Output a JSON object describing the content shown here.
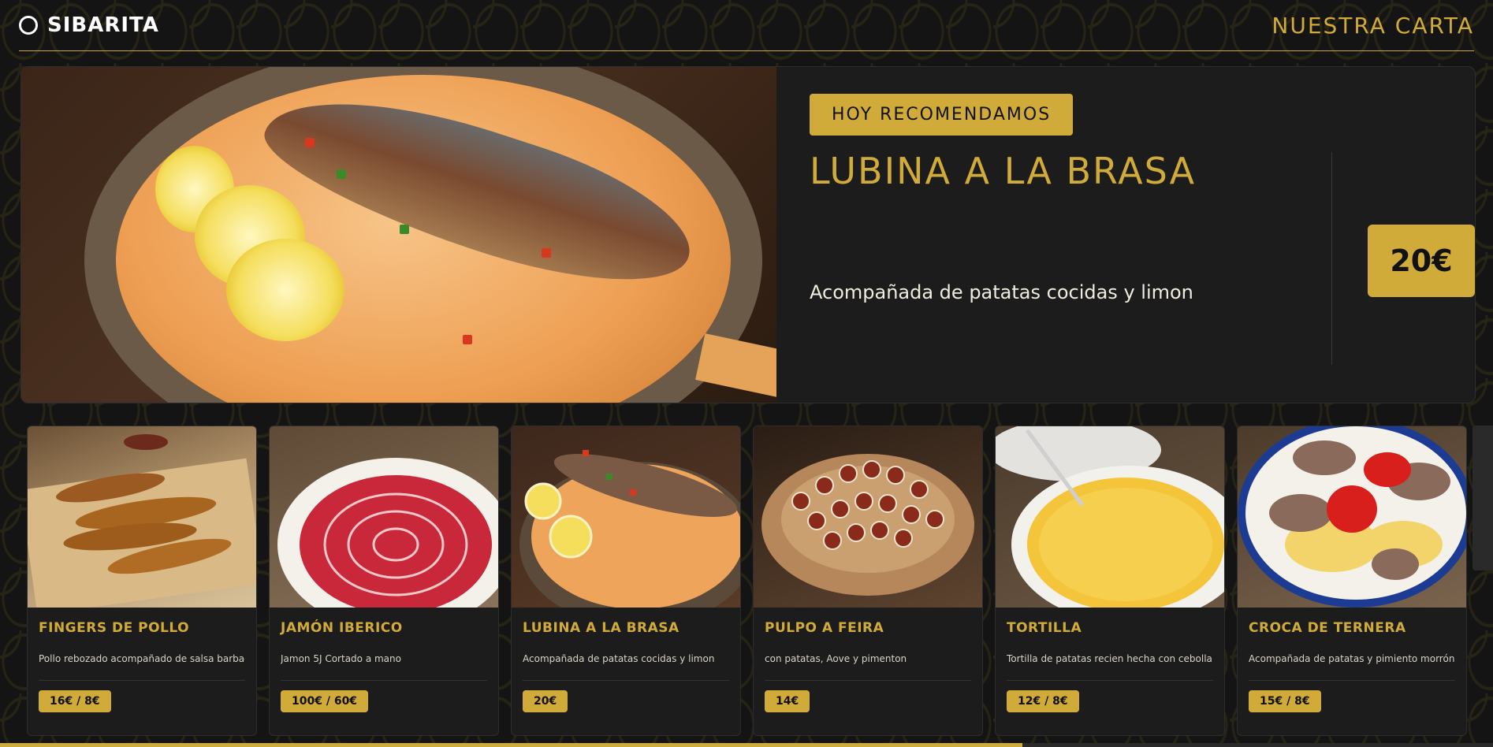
{
  "header": {
    "brand": "SIBARITA",
    "nav_link": "NUESTRA CARTA"
  },
  "hero": {
    "badge": "HOY RECOMENDAMOS",
    "title": "LUBINA A LA BRASA",
    "description": "Acompañada de patatas cocidas y limon",
    "price": "20€"
  },
  "cards": [
    {
      "title": "FINGERS DE POLLO",
      "description": "Pollo rebozado acompañado de salsa barbacoa",
      "price": "16€ / 8€"
    },
    {
      "title": "JAMÓN IBERICO",
      "description": "Jamon 5J Cortado a mano",
      "price": "100€ / 60€"
    },
    {
      "title": "LUBINA A LA BRASA",
      "description": "Acompañada de patatas cocidas y limon",
      "price": "20€"
    },
    {
      "title": "PULPO A FEIRA",
      "description": "con patatas, Aove y pimenton",
      "price": "14€"
    },
    {
      "title": "TORTILLA",
      "description": "Tortilla de patatas recien hecha con cebolla",
      "price": "12€ / 8€"
    },
    {
      "title": "CROCA DE TERNERA",
      "description": "Acompañada de patatas y pimiento morrón",
      "price": "15€ / 8€"
    }
  ],
  "scroll_progress_percent": 68.5,
  "colors": {
    "accent": "#d1ab39",
    "background": "#151515",
    "card": "#1c1c1c"
  }
}
